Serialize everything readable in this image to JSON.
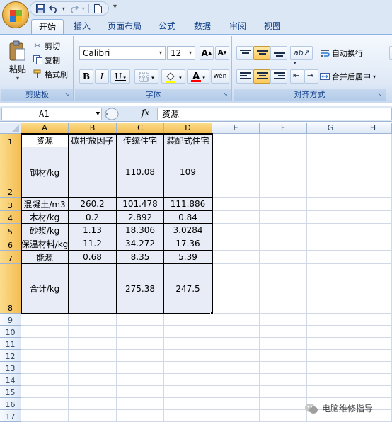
{
  "quick_access": {
    "save_icon": "save-icon",
    "undo_icon": "undo-icon",
    "redo_icon": "redo-icon",
    "new_icon": "new-document-icon"
  },
  "tabs": [
    {
      "label": "开始",
      "active": true
    },
    {
      "label": "插入"
    },
    {
      "label": "页面布局"
    },
    {
      "label": "公式"
    },
    {
      "label": "数据"
    },
    {
      "label": "审阅"
    },
    {
      "label": "视图"
    }
  ],
  "ribbon": {
    "clipboard": {
      "paste": "粘贴",
      "cut": "剪切",
      "copy": "复制",
      "format_painter": "格式刷",
      "group_label": "剪贴板"
    },
    "font": {
      "font_name": "Calibri",
      "font_size": "12",
      "grow": "A",
      "shrink": "A",
      "bold": "B",
      "italic": "I",
      "underline": "U",
      "font_color_letter": "A",
      "phonetic": "wén",
      "group_label": "字体",
      "highlight_color": "#ffff00",
      "font_color": "#ff0000"
    },
    "alignment": {
      "wrap_text": "自动换行",
      "merge_center": "合并后居中",
      "group_label": "对齐方式"
    }
  },
  "formula_bar": {
    "name_box": "A1",
    "fx": "fx",
    "content": "资源"
  },
  "sheet": {
    "columns": [
      "A",
      "B",
      "C",
      "D",
      "E",
      "F",
      "G",
      "H"
    ],
    "rows": [
      "1",
      "2",
      "3",
      "4",
      "5",
      "6",
      "7",
      "8",
      "9",
      "10",
      "11",
      "12",
      "13",
      "14",
      "15",
      "16",
      "17"
    ],
    "cells": [
      [
        "资源",
        "碳排放因子",
        "传统住宅",
        "装配式住宅"
      ],
      [
        "钢材/kg",
        "",
        "110.08",
        "109"
      ],
      [
        "混凝土/m3",
        "260.2",
        "101.478",
        "111.886"
      ],
      [
        "木材/kg",
        "0.2",
        "2.892",
        "0.84"
      ],
      [
        "砂浆/kg",
        "1.13",
        "18.306",
        "3.0284"
      ],
      [
        "保温材料/kg",
        "11.2",
        "34.272",
        "17.36"
      ],
      [
        "能源",
        "0.68",
        "8.35",
        "5.39"
      ],
      [
        "合计/kg",
        "",
        "275.38",
        "247.5"
      ]
    ]
  },
  "watermark": {
    "text": "电脑维修指导"
  }
}
